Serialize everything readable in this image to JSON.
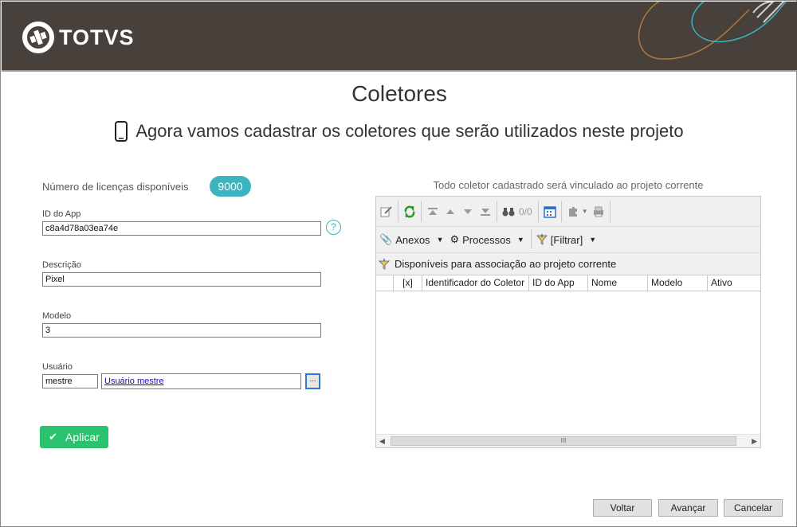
{
  "header": {
    "brand": "TOTVS"
  },
  "page": {
    "title": "Coletores",
    "subtitle": "Agora vamos cadastrar os coletores que serão utilizados neste projeto"
  },
  "licenses": {
    "label": "Número de licenças disponíveis",
    "count": "9000"
  },
  "form": {
    "app_id": {
      "label": "ID do App",
      "value": "c8a4d78a03ea74e"
    },
    "description": {
      "label": "Descrição",
      "value": "Pixel"
    },
    "model": {
      "label": "Modelo",
      "value": "3"
    },
    "user": {
      "label": "Usuário",
      "code": "mestre",
      "name": "Usuário mestre",
      "lookup": "..."
    },
    "help_symbol": "?",
    "apply_label": "Aplicar"
  },
  "grid": {
    "caption": "Todo coletor cadastrado será vinculado ao projeto corrente",
    "record_count": "0/0",
    "menu": {
      "attachments": "Anexos",
      "processes": "Processos",
      "filter": "[Filtrar]"
    },
    "group_label": "Disponíveis para associação ao projeto corrente",
    "columns": [
      "[x]",
      "Identificador do Coletor",
      "ID do App",
      "Nome",
      "Modelo",
      "Ativo"
    ],
    "scroll_thumb": "III"
  },
  "footer": {
    "back": "Voltar",
    "next": "Avançar",
    "cancel": "Cancelar"
  },
  "colors": {
    "header_bg": "#48403b",
    "accent": "#3bb4c1",
    "apply": "#2bc16f"
  }
}
